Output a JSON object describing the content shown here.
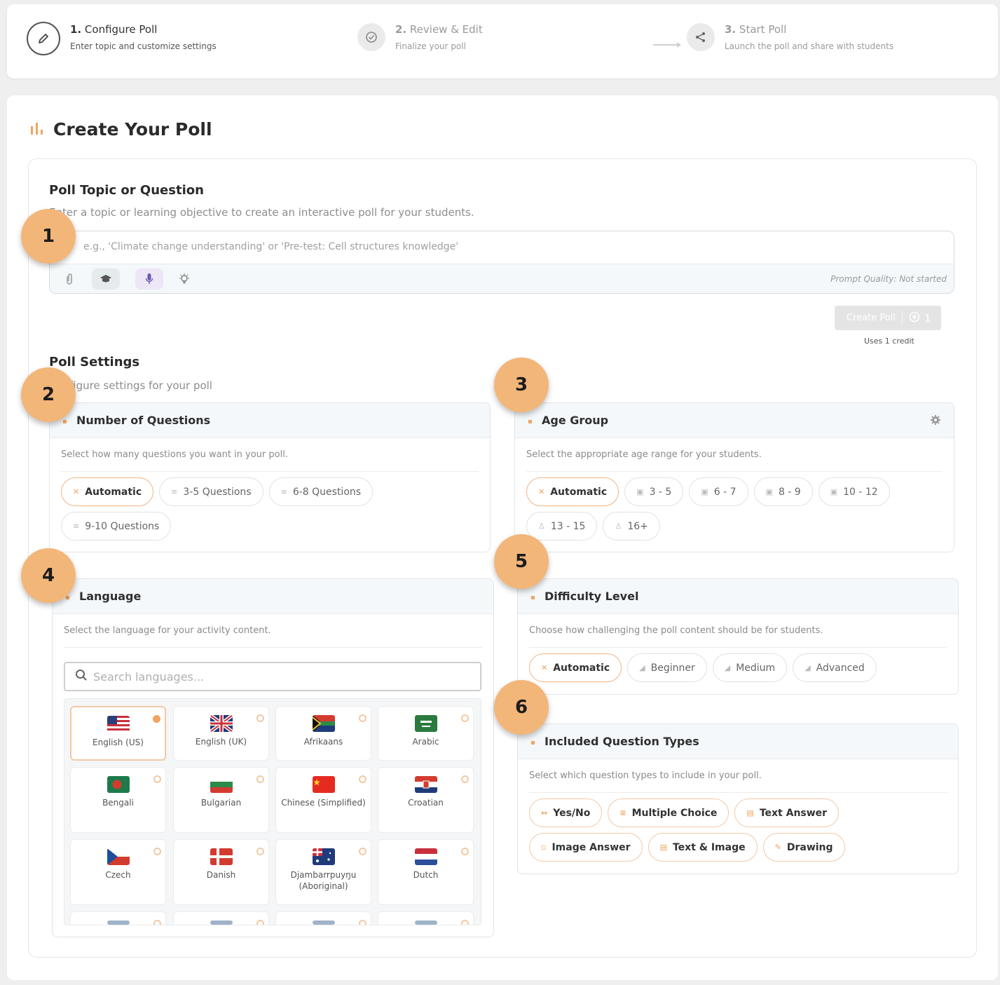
{
  "steps": [
    {
      "num": "1.",
      "title": "Configure Poll",
      "subtitle": "Enter topic and customize settings",
      "icon": "pencil-icon"
    },
    {
      "num": "2.",
      "title": "Review & Edit",
      "subtitle": "Finalize your poll",
      "icon": "check-circle-icon"
    },
    {
      "num": "3.",
      "title": "Start Poll",
      "subtitle": "Launch the poll and share with students",
      "icon": "share-icon"
    }
  ],
  "page": {
    "title": "Create Your Poll",
    "title_icon": "bar-chart-icon"
  },
  "topic": {
    "heading": "Poll Topic or Question",
    "subtitle": "Enter a topic or learning objective to create an interactive poll for your students.",
    "placeholder": "e.g., 'Climate change understanding' or 'Pre-test: Cell structures knowledge'",
    "quality_label": "Prompt Quality: Not started",
    "tools": [
      "paperclip-icon",
      "graduation-cap-icon",
      "microphone-icon",
      "lightbulb-icon"
    ]
  },
  "create_button": {
    "label": "Create Poll",
    "credits": "1",
    "note": "Uses 1 credit"
  },
  "settings": {
    "heading": "Poll Settings",
    "subtitle": "Configure settings for your poll"
  },
  "num_questions": {
    "title": "Number of Questions",
    "desc": "Select how many questions you want in your poll.",
    "options": [
      "Automatic",
      "3-5 Questions",
      "6-8 Questions",
      "9-10 Questions"
    ]
  },
  "age_group": {
    "title": "Age Group",
    "desc": "Select the appropriate age range for your students.",
    "options": [
      "Automatic",
      "3 - 5",
      "6 - 7",
      "8 - 9",
      "10 - 12",
      "13 - 15",
      "16+"
    ]
  },
  "language": {
    "title": "Language",
    "desc": "Select the language for your activity content.",
    "search_placeholder": "Search languages...",
    "items": [
      {
        "name": "English (US)"
      },
      {
        "name": "English (UK)"
      },
      {
        "name": "Afrikaans"
      },
      {
        "name": "Arabic"
      },
      {
        "name": "Bengali"
      },
      {
        "name": "Bulgarian"
      },
      {
        "name": "Chinese (Simplified)"
      },
      {
        "name": "Croatian"
      },
      {
        "name": "Czech"
      },
      {
        "name": "Danish"
      },
      {
        "name": "Djambarrpuyŋu (Aboriginal)"
      },
      {
        "name": "Dutch"
      }
    ],
    "selected": "English (US)"
  },
  "difficulty": {
    "title": "Difficulty Level",
    "desc": "Choose how challenging the poll content should be for students.",
    "options": [
      "Automatic",
      "Beginner",
      "Medium",
      "Advanced"
    ]
  },
  "question_types": {
    "title": "Included Question Types",
    "desc": "Select which question types to include in your poll.",
    "options": [
      "Yes/No",
      "Multiple Choice",
      "Text Answer",
      "Image Answer",
      "Text & Image",
      "Drawing"
    ]
  },
  "badges": [
    "1",
    "2",
    "3",
    "4",
    "5",
    "6"
  ],
  "colors": {
    "accent": "#f0a460",
    "badge": "#f3b679"
  }
}
